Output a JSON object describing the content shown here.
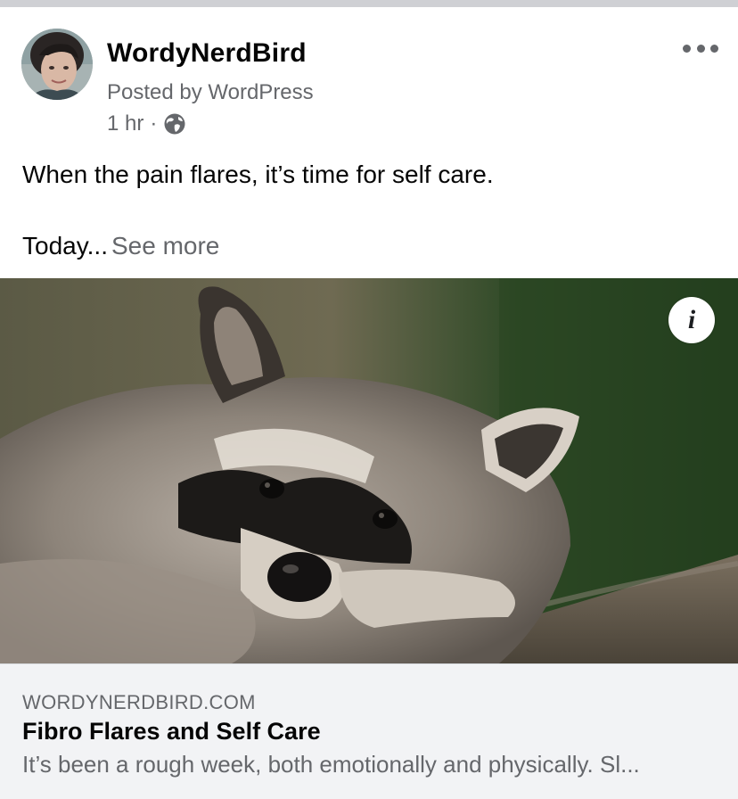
{
  "post": {
    "author": "WordyNerdBird",
    "posted_by": "Posted by WordPress",
    "time": "1 hr",
    "separator": "·",
    "audience_icon": "globe-icon",
    "more_icon": "more-options-icon",
    "text_line1": "When the pain flares, it’s time for self care.",
    "text_line2": "Today...",
    "see_more": "See more"
  },
  "link_preview": {
    "image_subject": "raccoon",
    "info_icon": "info-icon",
    "info_glyph": "i",
    "domain": "WORDYNERDBIRD.COM",
    "title": "Fibro Flares and Self Care",
    "description": "It’s been a rough week, both emotionally and physically. Sl..."
  },
  "colors": {
    "primary_text": "#050505",
    "secondary_text": "#65676b",
    "footer_background": "#f2f3f5"
  }
}
